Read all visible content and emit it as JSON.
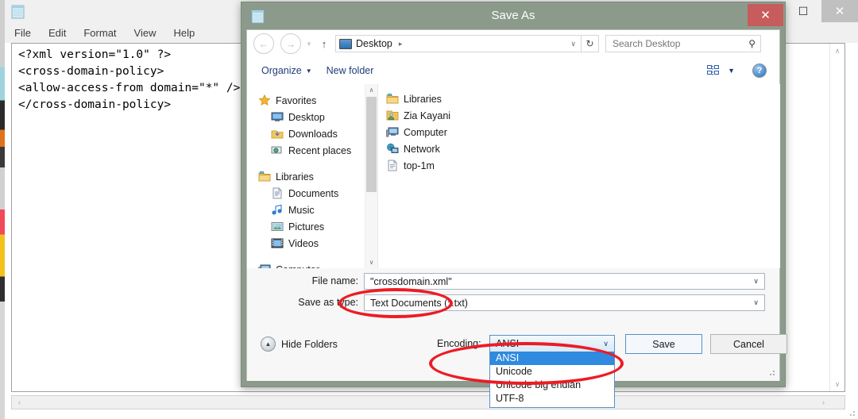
{
  "notepad": {
    "window_controls": {
      "minimize": "–",
      "maximize": "☐",
      "close": "✕"
    },
    "menu": [
      "File",
      "Edit",
      "Format",
      "View",
      "Help"
    ],
    "content": "<?xml version=\"1.0\" ?>\n<cross-domain-policy>\n<allow-access-from domain=\"*\" />\n</cross-domain-policy>",
    "scroll_up": "∧",
    "scroll_down": "∨",
    "scroll_left": "‹",
    "scroll_right": "›"
  },
  "dialog": {
    "title": "Save As",
    "close_label": "✕",
    "address": {
      "back": "←",
      "forward": "→",
      "recent_caret": "▼",
      "up": "↑",
      "path": "Desktop",
      "path_separator": "▸",
      "dropdown_caret": "∨",
      "refresh": "↻"
    },
    "search": {
      "placeholder": "Search Desktop",
      "icon": "⚲"
    },
    "toolbar": {
      "organize": "Organize",
      "organize_caret": "▼",
      "new_folder": "New folder",
      "view_caret": "▼",
      "help": "?"
    },
    "nav_tree": [
      {
        "label": "Favorites",
        "level": 1,
        "icon": "star-icon"
      },
      {
        "label": "Desktop",
        "level": 2,
        "icon": "monitor-icon"
      },
      {
        "label": "Downloads",
        "level": 2,
        "icon": "downloads-icon"
      },
      {
        "label": "Recent places",
        "level": 2,
        "icon": "recent-places-icon"
      },
      {
        "label": "Libraries",
        "level": 1,
        "icon": "libraries-icon"
      },
      {
        "label": "Documents",
        "level": 2,
        "icon": "documents-icon"
      },
      {
        "label": "Music",
        "level": 2,
        "icon": "music-icon"
      },
      {
        "label": "Pictures",
        "level": 2,
        "icon": "pictures-icon"
      },
      {
        "label": "Videos",
        "level": 2,
        "icon": "videos-icon"
      },
      {
        "label": "Computer",
        "level": 1,
        "icon": "computer-icon"
      }
    ],
    "nav_scroll": {
      "up": "∧",
      "down": "∨"
    },
    "file_list": [
      {
        "label": "Libraries",
        "icon": "libraries-icon"
      },
      {
        "label": "Zia Kayani",
        "icon": "user-folder-icon"
      },
      {
        "label": "Computer",
        "icon": "computer-icon"
      },
      {
        "label": "Network",
        "icon": "network-icon"
      },
      {
        "label": "top-1m",
        "icon": "text-file-icon"
      }
    ],
    "form": {
      "file_name_label": "File name:",
      "file_name_value": "\"crossdomain.xml\"",
      "save_as_type_label": "Save as type:",
      "save_as_type_value": "Text Documents (*.txt)",
      "caret": "∨"
    },
    "footer": {
      "hide_folders": "Hide Folders",
      "hide_folders_icon": "▲",
      "encoding_label": "Encoding:",
      "encoding_value": "ANSI",
      "encoding_caret": "∨",
      "encoding_options": [
        "ANSI",
        "Unicode",
        "Unicode big endian",
        "UTF-8"
      ],
      "encoding_selected_index": 0,
      "save": "Save",
      "cancel": "Cancel"
    }
  },
  "annotations": {
    "color": "#ec1c24",
    "shapes": [
      "ellipse-around-file-name",
      "ellipse-around-encoding"
    ]
  }
}
